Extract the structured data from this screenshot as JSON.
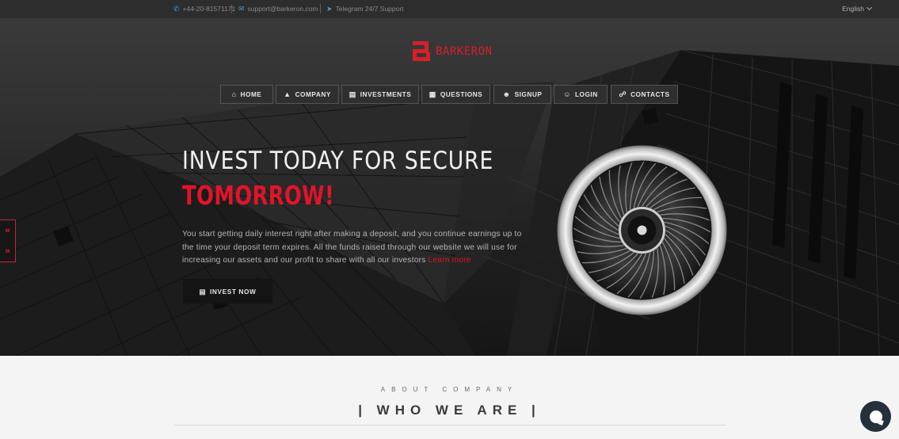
{
  "topbar": {
    "phone": "+44-20-81571171",
    "email": "support@barkeron.com",
    "telegram": "Telegram 24/7 Support",
    "language": "English"
  },
  "brand": {
    "name": "BARKERON",
    "accent": "#d81f2a"
  },
  "nav": {
    "items": [
      {
        "label": "HOME",
        "icon": "home-icon"
      },
      {
        "label": "COMPANY",
        "icon": "stamp-icon"
      },
      {
        "label": "INVESTMENTS",
        "icon": "briefcase-icon"
      },
      {
        "label": "QUESTIONS",
        "icon": "building-icon"
      },
      {
        "label": "SIGNUP",
        "icon": "user-plus-icon"
      },
      {
        "label": "LOGIN",
        "icon": "user-lock-icon"
      },
      {
        "label": "CONTACTS",
        "icon": "handshake-icon"
      }
    ]
  },
  "hero": {
    "headline_line1": "INVEST TODAY FOR SECURE",
    "headline_line2": "TOMORROW!",
    "description": "You start getting daily interest right after making a deposit, and you continue earnings up to the time your deposit term expires. All the funds raised through our website we will use for increasing our assets and our profit to share with all our investors",
    "learn_more": "Learn more",
    "cta_label": "INVEST NOW"
  },
  "about": {
    "subtitle": "ABOUT COMPANY",
    "title": "| WHO WE ARE |"
  },
  "colors": {
    "hero_dark": "#1e1e1e",
    "topbar": "#2d2d2d",
    "accent_red": "#e0142a",
    "chat": "#25303b"
  }
}
